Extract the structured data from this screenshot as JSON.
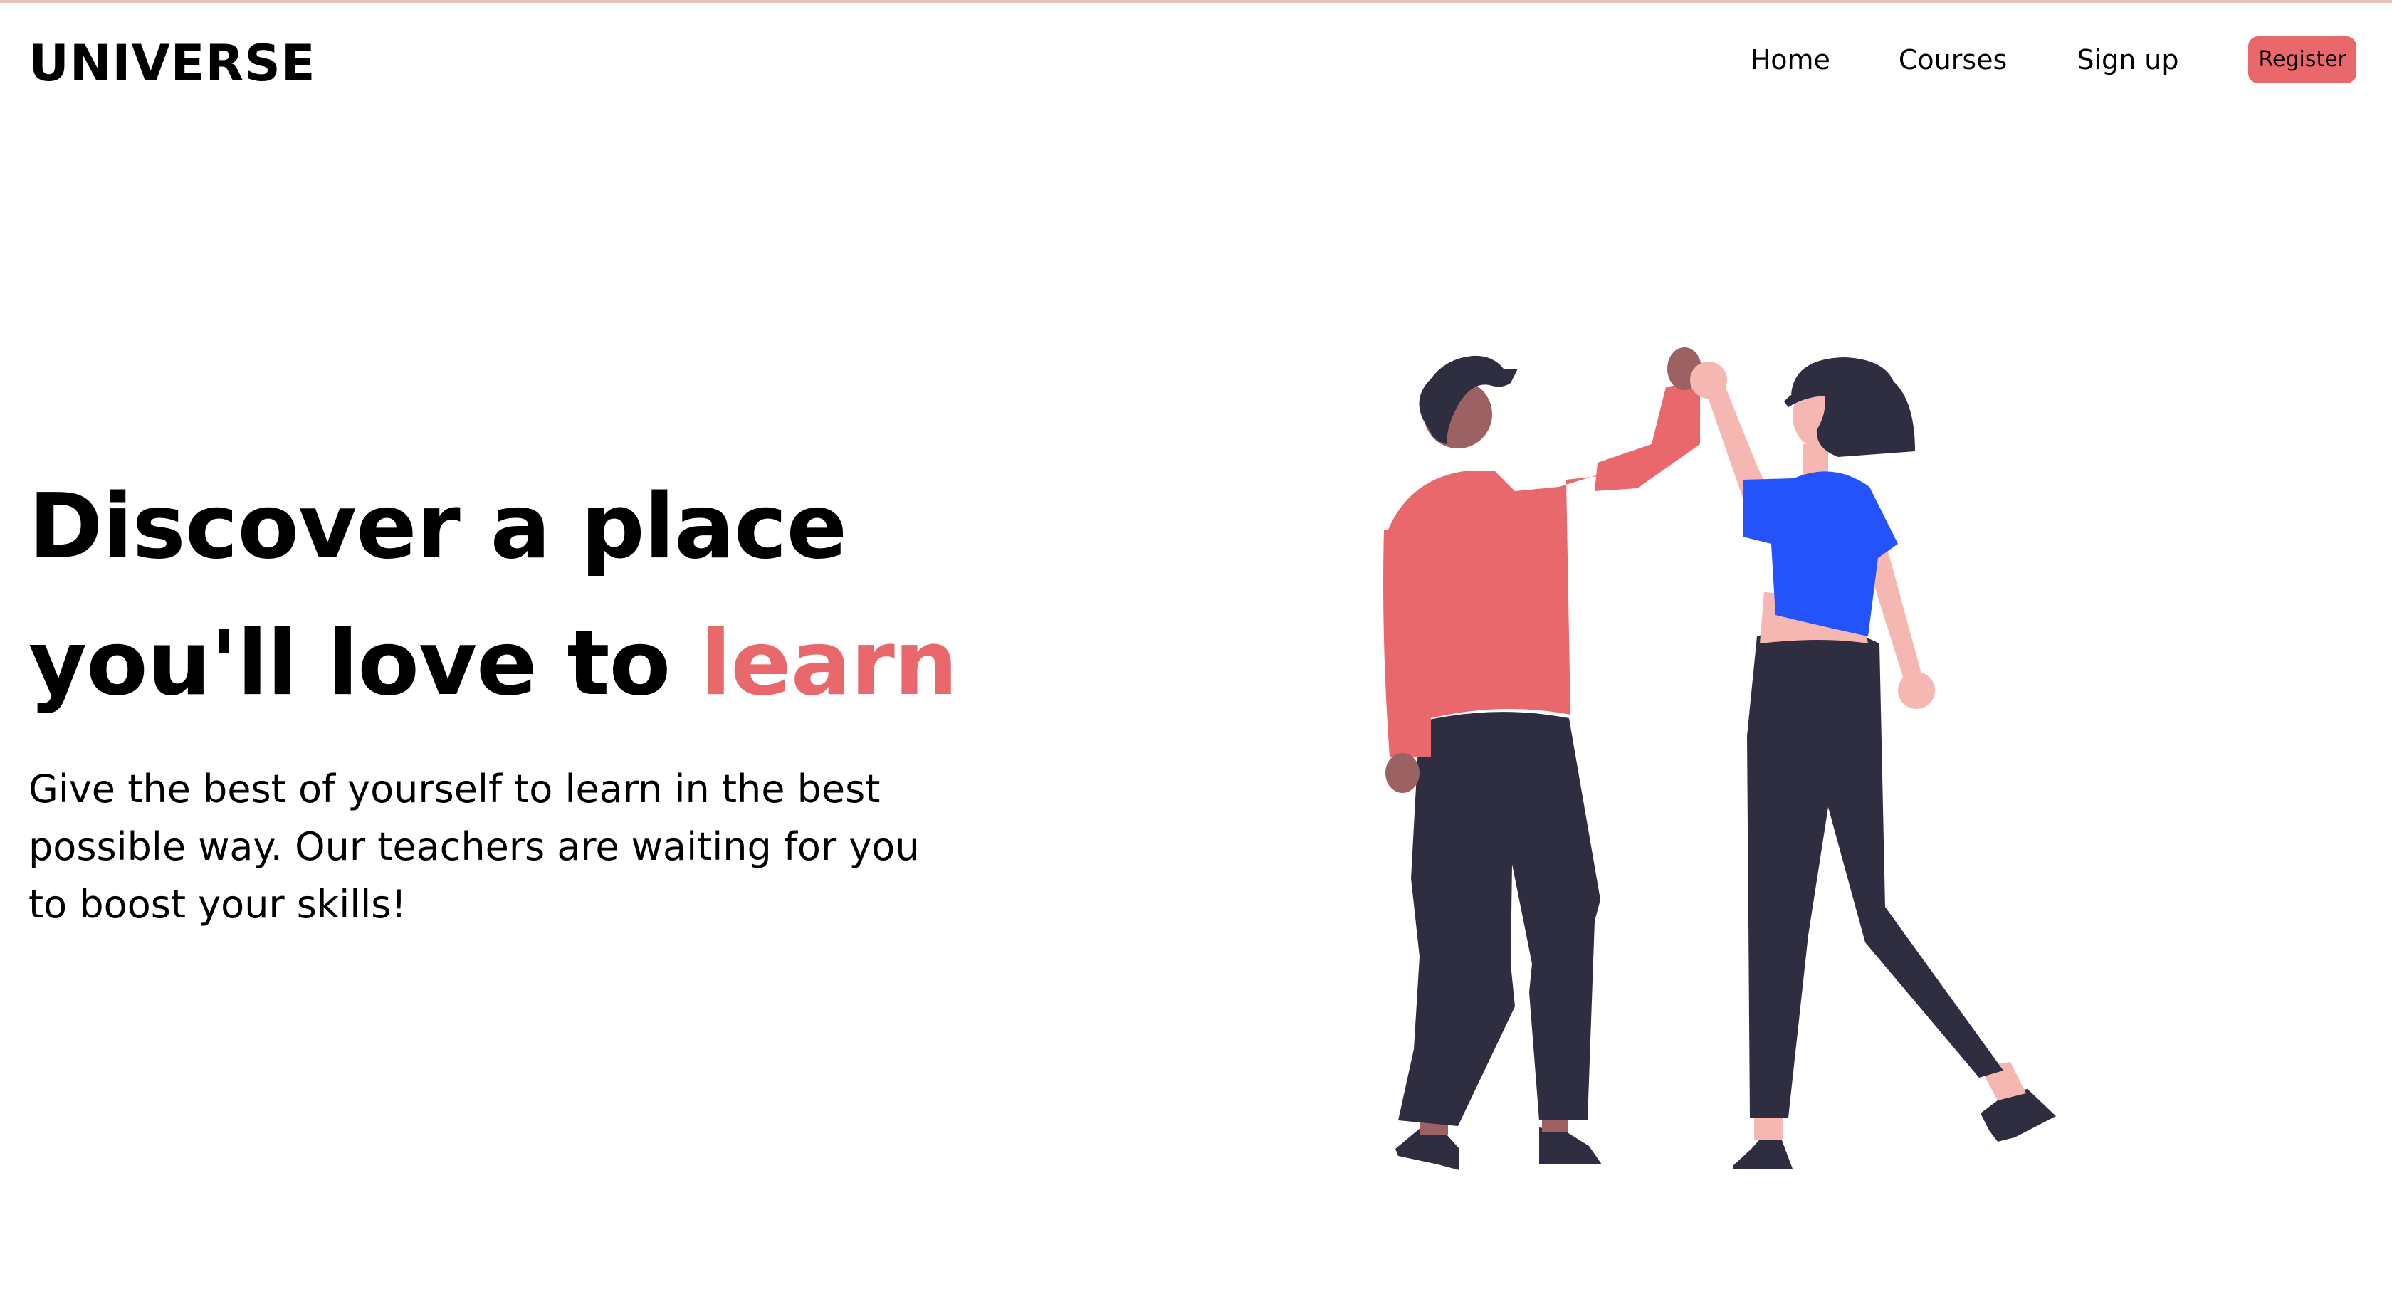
{
  "header": {
    "logo": "UNIVERSE",
    "nav": [
      {
        "label": "Home"
      },
      {
        "label": "Courses"
      },
      {
        "label": "Sign up"
      }
    ],
    "register_label": "Register"
  },
  "hero": {
    "title_line1": "Discover a place",
    "title_line2_prefix": "you'll love to ",
    "title_accent": "learn",
    "subtitle": "Give the best of yourself to learn in the best possible way. Our teachers are waiting for you to boost your skills!"
  },
  "colors": {
    "accent": "#e9686c",
    "shirt_blue": "#2452fb",
    "pants": "#2f2e41",
    "skin_light": "#f4b7b1",
    "skin_dark": "#9b6163"
  },
  "illustration": {
    "name": "two-people-high-five"
  }
}
